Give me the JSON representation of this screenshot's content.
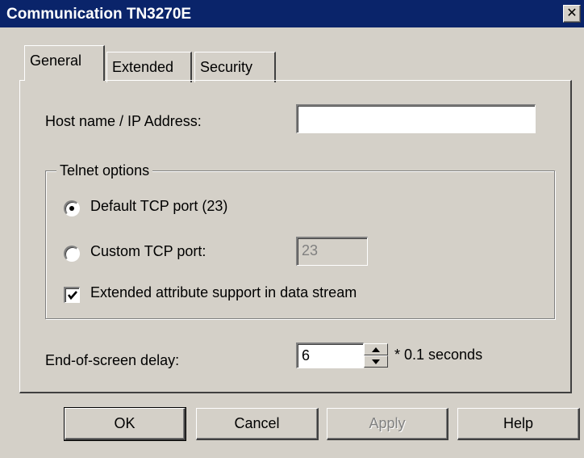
{
  "window": {
    "title": "Communication TN3270E",
    "close_glyph": "✕"
  },
  "tabs": [
    {
      "label": "General",
      "active": true
    },
    {
      "label": "Extended",
      "active": false
    },
    {
      "label": "Security",
      "active": false
    }
  ],
  "general": {
    "host_label": "Host name / IP Address:",
    "host_value": "",
    "telnet_group_label": "Telnet options",
    "default_port_label": "Default TCP port (23)",
    "default_port_selected": true,
    "custom_port_label": "Custom TCP port:",
    "custom_port_selected": false,
    "custom_port_value": "23",
    "extended_attr_label": "Extended attribute support in data stream",
    "extended_attr_checked": true,
    "delay_label": "End-of-screen delay:",
    "delay_value": "6",
    "delay_unit": "* 0.1 seconds"
  },
  "buttons": {
    "ok": "OK",
    "cancel": "Cancel",
    "apply": "Apply",
    "help": "Help"
  }
}
